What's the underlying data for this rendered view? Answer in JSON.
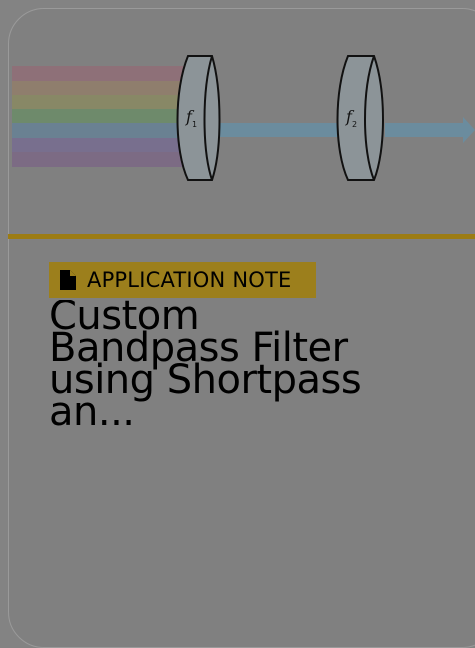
{
  "figure": {
    "lens_1_label": "f",
    "lens_1_subscript": "1",
    "lens_2_label": "f",
    "lens_2_subscript": "2",
    "spectrum_colors": [
      "#8f6f7a",
      "#8f7f6c",
      "#8a8a66",
      "#6f8a6a",
      "#6a7f90",
      "#7a6f8f",
      "#7f6a86"
    ],
    "beam_color": "#6b8c9e"
  },
  "badge": {
    "icon": "document-icon",
    "label": "APPLICATION NOTE"
  },
  "article": {
    "title": "Custom Bandpass Filter using Shortpass an..."
  },
  "colors": {
    "overlay": "#808080",
    "accent": "#9c7c14",
    "badge_bg": "#9c7f1c"
  }
}
